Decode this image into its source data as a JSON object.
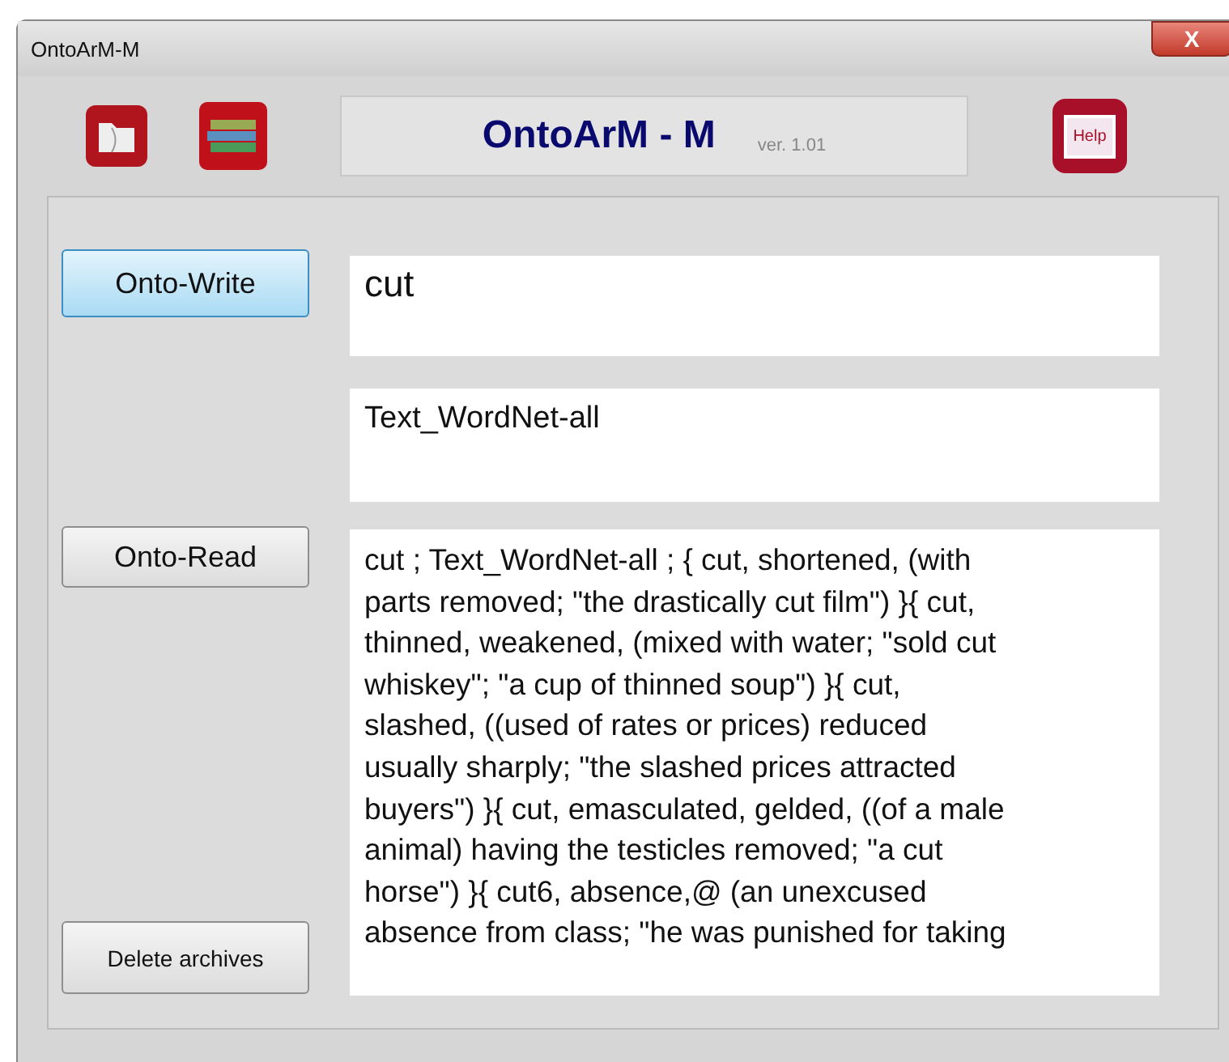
{
  "window": {
    "title": "OntoArM-M",
    "close_label": "X"
  },
  "header": {
    "title": "OntoArM - M",
    "version": "ver. 1.01",
    "help_label": "Help"
  },
  "buttons": [
    {
      "label": "Onto-Write",
      "focused": true
    },
    {
      "label": "Onto-Read",
      "focused": false
    },
    {
      "label": "Delete archives",
      "focused": false
    }
  ],
  "word_field": {
    "value": "cut"
  },
  "source_field": {
    "value": "Text_WordNet-all"
  },
  "output_lines": [
    "cut ; Text_WordNet-all ; { cut, shortened, (with",
    "parts removed; \"the drastically cut film\") }{ cut,",
    "thinned, weakened, (mixed with water; \"sold cut",
    "whiskey\"; \"a cup of thinned soup\") }{ cut,",
    "slashed, ((used of rates or prices) reduced",
    "usually sharply; \"the slashed prices attracted",
    "buyers\") }{ cut, emasculated, gelded, ((of a male",
    "animal) having the testicles removed; \"a cut",
    "horse\") }{ cut6, absence,@ (an unexcused",
    "absence from class; \"he was punished for taking"
  ]
}
